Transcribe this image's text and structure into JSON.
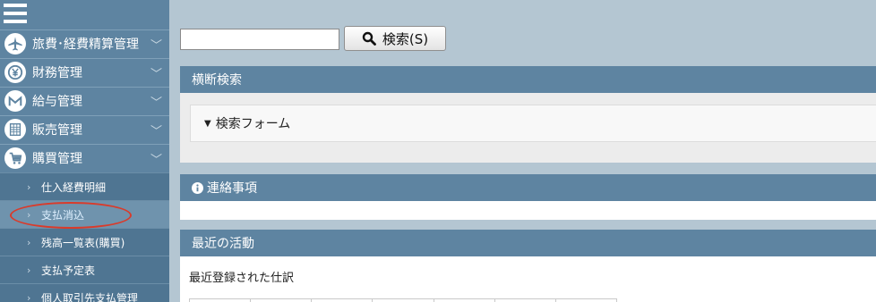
{
  "sidebar": {
    "menu": [
      {
        "label": "旅費･経費精算管理",
        "icon": "airplane-icon"
      },
      {
        "label": "財務管理",
        "icon": "yen-coin-icon"
      },
      {
        "label": "給与管理",
        "icon": "envelope-icon"
      },
      {
        "label": "販売管理",
        "icon": "building-icon"
      },
      {
        "label": "購買管理",
        "icon": "cart-icon"
      }
    ],
    "submenu": [
      {
        "label": "仕入経費明細"
      },
      {
        "label": "支払消込",
        "active": true
      },
      {
        "label": "残高一覧表(購買)"
      },
      {
        "label": "支払予定表"
      },
      {
        "label": "個人取引先支払管理"
      }
    ],
    "expand_glyph": "﹀",
    "sub_glyph": "›"
  },
  "search": {
    "value": "",
    "button_label": "検索(S)"
  },
  "panels": {
    "cross_search": {
      "title": "横断検索",
      "form_toggle": "検索フォーム"
    },
    "notice": {
      "title": "連絡事項"
    },
    "recent": {
      "title": "最近の活動",
      "caption": "最近登録された仕訳"
    }
  },
  "colors": {
    "sidebar": "#5e84a1",
    "panel_header": "#5e84a1",
    "background": "#b4c6d2",
    "annotation": "#d93b2b"
  }
}
